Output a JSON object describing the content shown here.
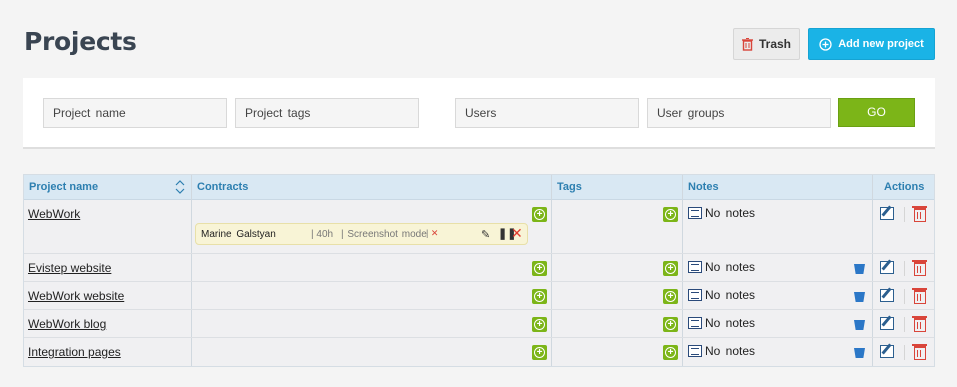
{
  "page": {
    "title": "Projects"
  },
  "toolbar": {
    "trash_label": "Trash",
    "add_label": "Add new project"
  },
  "filters": {
    "project_name_placeholder": "Project name",
    "project_tags_placeholder": "Project tags",
    "users_placeholder": "Users",
    "user_groups_placeholder": "User groups",
    "go_label": "GO"
  },
  "table": {
    "columns": {
      "project_name": "Project name",
      "contracts": "Contracts",
      "tags": "Tags",
      "notes": "Notes",
      "actions": "Actions"
    },
    "rows": [
      {
        "name": "WebWork",
        "notes": "No notes"
      },
      {
        "name": "Evistep website",
        "notes": "No notes"
      },
      {
        "name": "WebWork website",
        "notes": "No notes"
      },
      {
        "name": "WebWork blog",
        "notes": "No notes"
      },
      {
        "name": "Integration pages",
        "notes": "No notes"
      }
    ],
    "contract": {
      "user": "Marine Galstyan",
      "hours": "| 40h",
      "mode": "| Screenshot mode",
      "divider": "|"
    }
  },
  "colors": {
    "accent_blue": "#1ab3e6",
    "go_green": "#7cb518",
    "delete_red": "#d9453a",
    "header_bg": "#d9e8f3"
  }
}
